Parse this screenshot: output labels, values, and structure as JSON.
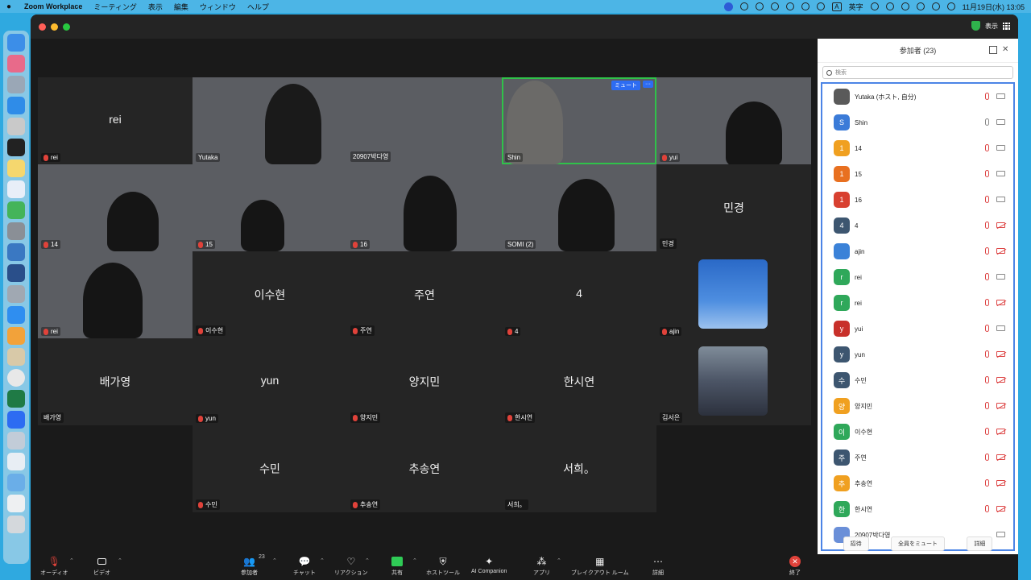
{
  "menubar": {
    "app_name": "Zoom Workplace",
    "menus": [
      "ミーティング",
      "表示",
      "編集",
      "ウィンドウ",
      "ヘルプ"
    ],
    "ime": "A",
    "ime_label": "英字",
    "clock": "11月19日(水) 13:05"
  },
  "titlebar": {
    "view_label": "表示"
  },
  "tiles": [
    {
      "id": "t1",
      "big": "rei",
      "tag": "rei",
      "muted": true,
      "video": false
    },
    {
      "id": "t2",
      "big": "",
      "tag": "Yutaka",
      "muted": false,
      "video": true
    },
    {
      "id": "t3",
      "big": "",
      "tag": "20907박다영",
      "muted": false,
      "video": true
    },
    {
      "id": "t4",
      "big": "",
      "tag": "Shin",
      "muted": false,
      "video": true
    },
    {
      "id": "t5",
      "big": "",
      "tag": "yui",
      "muted": true,
      "video": true
    },
    {
      "id": "t6",
      "big": "",
      "tag": "14",
      "muted": true,
      "video": true
    },
    {
      "id": "t7",
      "big": "",
      "tag": "15",
      "muted": true,
      "video": true
    },
    {
      "id": "t8",
      "big": "",
      "tag": "16",
      "muted": true,
      "video": true
    },
    {
      "id": "t9",
      "big": "",
      "tag": "SOMI (2)",
      "muted": false,
      "video": true
    },
    {
      "id": "t10",
      "big": "민경",
      "tag": "민경",
      "muted": false,
      "video": false
    },
    {
      "id": "t11",
      "big": "",
      "tag": "rei",
      "muted": true,
      "video": true
    },
    {
      "id": "t12",
      "big": "이수현",
      "tag": "이수현",
      "muted": true,
      "video": false
    },
    {
      "id": "t13",
      "big": "주연",
      "tag": "주연",
      "muted": true,
      "video": false
    },
    {
      "id": "t14",
      "big": "4",
      "tag": "4",
      "muted": true,
      "video": false
    },
    {
      "id": "t15",
      "big": "",
      "tag": "ajin",
      "muted": true,
      "video": false
    },
    {
      "id": "t16",
      "big": "배가영",
      "tag": "배가영",
      "muted": false,
      "video": false
    },
    {
      "id": "t17",
      "big": "yun",
      "tag": "yun",
      "muted": true,
      "video": false
    },
    {
      "id": "t18",
      "big": "양지민",
      "tag": "양지민",
      "muted": true,
      "video": false
    },
    {
      "id": "t19",
      "big": "한시연",
      "tag": "한시연",
      "muted": true,
      "video": false
    },
    {
      "id": "t20",
      "big": "",
      "tag": "김서은",
      "muted": false,
      "video": false
    },
    {
      "id": "t21",
      "big": "수민",
      "tag": "수민",
      "muted": true,
      "video": false
    },
    {
      "id": "t22",
      "big": "추송연",
      "tag": "추송연",
      "muted": true,
      "video": false
    },
    {
      "id": "t23",
      "big": "서희。",
      "tag": "서희。",
      "muted": false,
      "video": false
    }
  ],
  "active_tile": {
    "mute_label": "ミュート",
    "more_label": "···"
  },
  "panel": {
    "title": "参加者 (23)",
    "search_placeholder": "検索",
    "participants": [
      {
        "name": "Yutaka (ホスト, 自分)",
        "initial": "",
        "color": "#5a5a5a",
        "mic": "off",
        "cam": "on"
      },
      {
        "name": "Shin",
        "initial": "S",
        "color": "#3b7bd8",
        "mic": "on",
        "cam": "on"
      },
      {
        "name": "14",
        "initial": "1",
        "color": "#f0a020",
        "mic": "off",
        "cam": "on"
      },
      {
        "name": "15",
        "initial": "1",
        "color": "#e87020",
        "mic": "off",
        "cam": "on"
      },
      {
        "name": "16",
        "initial": "1",
        "color": "#d84030",
        "mic": "off",
        "cam": "on"
      },
      {
        "name": "4",
        "initial": "4",
        "color": "#3d5670",
        "mic": "off",
        "cam": "off"
      },
      {
        "name": "ajin",
        "initial": "",
        "color": "#3b82d8",
        "mic": "off",
        "cam": "off"
      },
      {
        "name": "rei",
        "initial": "r",
        "color": "#2fa85a",
        "mic": "off",
        "cam": "on"
      },
      {
        "name": "rei",
        "initial": "r",
        "color": "#2fa85a",
        "mic": "off",
        "cam": "off"
      },
      {
        "name": "yui",
        "initial": "y",
        "color": "#c8302a",
        "mic": "off",
        "cam": "on"
      },
      {
        "name": "yun",
        "initial": "y",
        "color": "#3d5670",
        "mic": "off",
        "cam": "off"
      },
      {
        "name": "수민",
        "initial": "수",
        "color": "#3d5670",
        "mic": "off",
        "cam": "off"
      },
      {
        "name": "양지민",
        "initial": "양",
        "color": "#f0a020",
        "mic": "off",
        "cam": "off"
      },
      {
        "name": "이수현",
        "initial": "이",
        "color": "#2fa85a",
        "mic": "off",
        "cam": "off"
      },
      {
        "name": "주연",
        "initial": "주",
        "color": "#3d5670",
        "mic": "off",
        "cam": "off"
      },
      {
        "name": "추송연",
        "initial": "추",
        "color": "#f0a020",
        "mic": "off",
        "cam": "off"
      },
      {
        "name": "한시연",
        "initial": "한",
        "color": "#2fa85a",
        "mic": "off",
        "cam": "off"
      },
      {
        "name": "20907박다영",
        "initial": "",
        "color": "#6a8fd8",
        "mic": "none",
        "cam": "on"
      }
    ],
    "invite_label": "招待",
    "mute_all_label": "全員をミュート",
    "more_label": "詳細"
  },
  "toolbar": {
    "audio_label": "オーディオ",
    "video_label": "ビデオ",
    "participants_label": "参加者",
    "participants_count": "23",
    "chat_label": "チャット",
    "reaction_label": "リアクション",
    "share_label": "共有",
    "host_tools_label": "ホストツール",
    "ai_label": "AI Companion",
    "apps_label": "アプリ",
    "breakout_label": "ブレイクアウト ルーム",
    "more_label": "詳細",
    "end_label": "終了"
  }
}
